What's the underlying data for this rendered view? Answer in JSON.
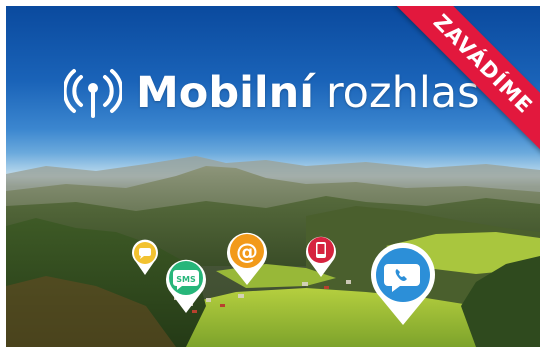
{
  "banner": {
    "title_bold": "Mobilní",
    "title_light": "rozhlas",
    "ribbon_label": "ZAVÁDÍME",
    "logo_icon": "radio-broadcast-icon"
  },
  "pins": [
    {
      "icon": "chat-icon",
      "color": "#f2c230"
    },
    {
      "icon": "sms-icon",
      "label": "SMS",
      "color": "#27b67a"
    },
    {
      "icon": "email-at-icon",
      "label": "@",
      "color": "#f29a1a"
    },
    {
      "icon": "mobile-phone-icon",
      "color": "#d6233f"
    },
    {
      "icon": "phone-call-icon",
      "color": "#2c8fd8"
    }
  ],
  "colors": {
    "sky_top": "#0a4a9e",
    "ribbon": "#e2183d",
    "text": "#ffffff"
  }
}
